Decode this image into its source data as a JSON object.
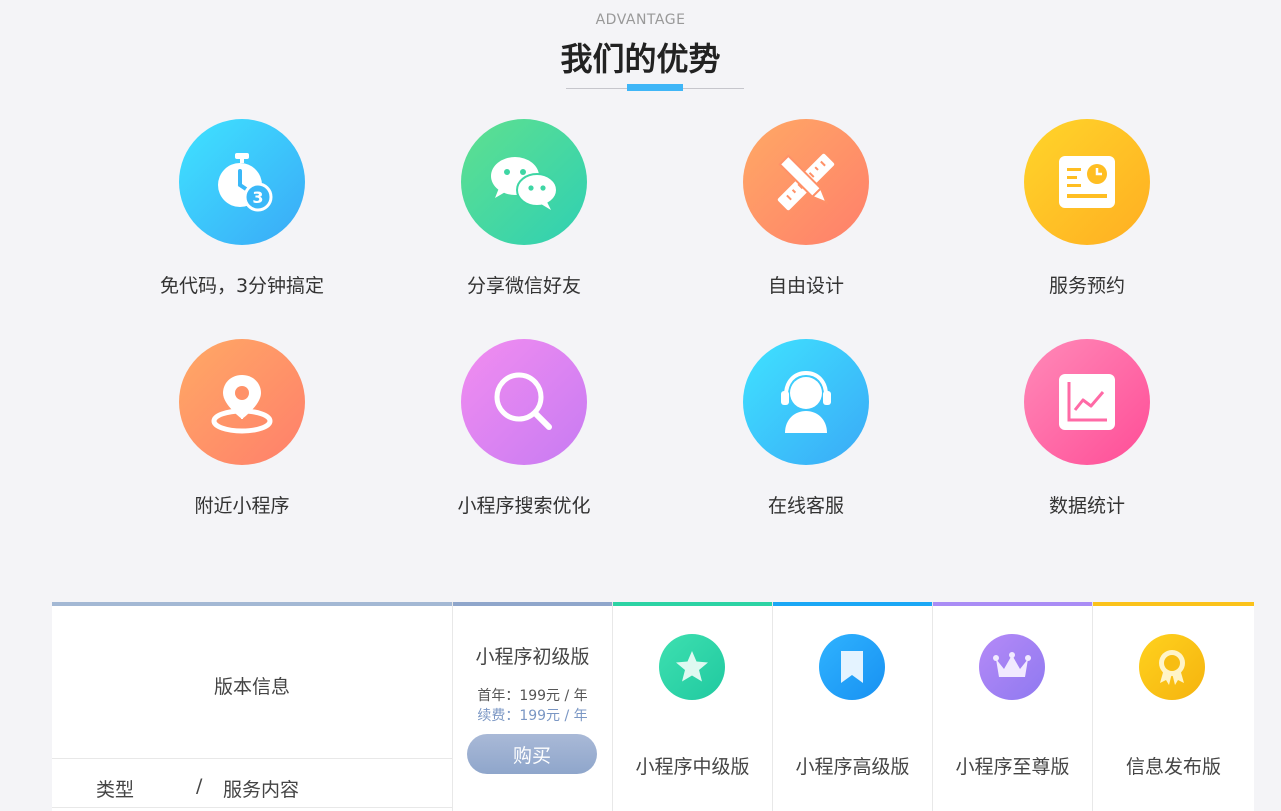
{
  "section": {
    "subtitle": "ADVANTAGE",
    "title": "我们的优势"
  },
  "features": [
    {
      "label": "免代码，3分钟搞定",
      "icon": "stopwatch-icon",
      "color": "#2fc4f8"
    },
    {
      "label": "分享微信好友",
      "icon": "wechat-icon",
      "color": "#3fd6a0"
    },
    {
      "label": "自由设计",
      "icon": "ruler-pencil-icon",
      "color": "#ff8f66"
    },
    {
      "label": "服务预约",
      "icon": "schedule-card-icon",
      "color": "#ffbd1f"
    },
    {
      "label": "附近小程序",
      "icon": "location-pin-icon",
      "color": "#ff8f66"
    },
    {
      "label": "小程序搜索优化",
      "icon": "search-icon",
      "color": "#d77ef0"
    },
    {
      "label": "在线客服",
      "icon": "customer-service-icon",
      "color": "#36c6fa"
    },
    {
      "label": "数据统计",
      "icon": "line-chart-icon",
      "color": "#ff5fa2"
    }
  ],
  "table": {
    "version_info": "版本信息",
    "type_label": "类型",
    "slash": "/",
    "service_label": "服务内容",
    "plans": [
      {
        "name": "小程序初级版",
        "first_year": "首年：199元 / 年",
        "renewal": "续费：199元 / 年",
        "buy_label": "购买",
        "bar_color": "#8fa6cb"
      },
      {
        "name": "小程序中级版",
        "icon": "star-icon",
        "bar_color": "#2cd3a4"
      },
      {
        "name": "小程序高级版",
        "icon": "bookmark-icon",
        "bar_color": "#1aa7f5"
      },
      {
        "name": "小程序至尊版",
        "icon": "crown-icon",
        "bar_color": "#a98cf5"
      },
      {
        "name": "信息发布版",
        "icon": "medal-icon",
        "bar_color": "#fbc21a"
      }
    ]
  }
}
